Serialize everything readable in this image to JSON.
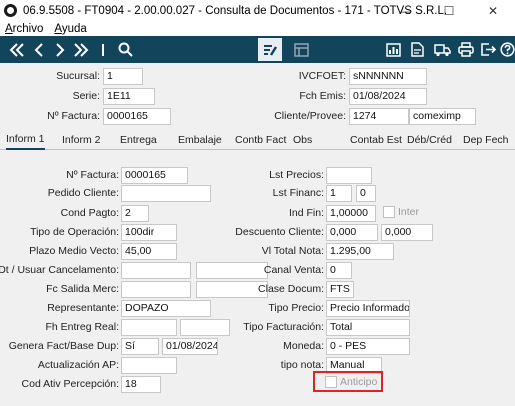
{
  "window": {
    "title": "06.9.5508 - FT0904 - 2.00.00.027 - Consulta de Documentos - 171 - TOTVS S.R.L.",
    "minimize": "—",
    "maximize": "☐",
    "close": "✕"
  },
  "menu": {
    "archivo_first": "A",
    "archivo_rest": "rchivo",
    "ayuda_first": "A",
    "ayuda_rest": "yuda"
  },
  "toolbar": {
    "left_icons": [
      "first-icon",
      "previous-icon",
      "next-icon",
      "last-icon",
      "search-icon"
    ],
    "right_icons": [
      "edit-icon",
      "grid-icon",
      "chart-icon",
      "document-icon",
      "truck-icon",
      "print-icon",
      "exit-icon",
      "help-icon"
    ]
  },
  "header": {
    "sucursal_label": "Sucursal:",
    "sucursal_value": "1",
    "serie_label": "Serie:",
    "serie_value": "1E11",
    "nfactura_label": "Nº Factura:",
    "nfactura_value": "0000165",
    "ivcfoet_label": "IVCFOET:",
    "ivcfoet_value": "sNNNNNN",
    "fchemis_label": "Fch Emis:",
    "fchemis_value": "01/08/2024",
    "cliente_label": "Cliente/Provee:",
    "cliente_code": "1274",
    "cliente_name": "comeximp"
  },
  "tabs": [
    "Inform 1",
    "Inform 2",
    "Entrega",
    "Embalaje",
    "Contb Fact",
    "Obs",
    "Contab Est",
    "Déb/Créd",
    "Dep Fech"
  ],
  "form": {
    "nfactura_label": "Nº Factura:",
    "nfactura_value": "0000165",
    "pedido_label": "Pedido Cliente:",
    "pedido_value": "",
    "condpagto_label": "Cond Pagto:",
    "condpagto_value": "2",
    "tipooper_label": "Tipo de Operación:",
    "tipooper_value": "100dir",
    "plazo_label": "Plazo Medio Vecto:",
    "plazo_value": "45,00",
    "dtusuar_label": "Dt / Usuar Cancelamento:",
    "dtusuar_value1": "",
    "dtusuar_value2": "",
    "fcsalida_label": "Fc Salida Merc:",
    "fcsalida_value1": "",
    "fcsalida_value2": "",
    "represent_label": "Representante:",
    "represent_value": "DOPAZO",
    "fhentreg_label": "Fh Entreg Real:",
    "fhentreg_value1": "",
    "fhentreg_value2": "",
    "genera_label": "Genera Fact/Base Dup:",
    "genera_value1": "Sí",
    "genera_value2": "01/08/2024",
    "actualiz_label": "Actualización AP:",
    "actualiz_value": "",
    "codativ_label": "Cod Ativ Percepción:",
    "codativ_value": "18",
    "lstprecios_label": "Lst Precios:",
    "lstprecios_value": "",
    "lstfinanc_label": "Lst Financ:",
    "lstfinanc_value1": "1",
    "lstfinanc_value2": "0",
    "indfin_label": "Ind Fin:",
    "indfin_value": "1,00000",
    "inter_label": "Inter",
    "descuento_label": "Descuento Cliente:",
    "descuento_value1": "0,000",
    "descuento_value2": "0,000",
    "vltotal_label": "Vl Total Nota:",
    "vltotal_value": "1.295,00",
    "canalventa_label": "Canal Venta:",
    "canalventa_value": "0",
    "clasedocum_label": "Clase Docum:",
    "clasedocum_value": "FTS",
    "tipoprecio_label": "Tipo Precio:",
    "tipoprecio_value": "Precio Informado",
    "tipofact_label": "Tipo Facturación:",
    "tipofact_value": "Total",
    "moneda_label": "Moneda:",
    "moneda_value": "0 - PES",
    "tiponota_label": "tipo nota:",
    "tiponota_value": "Manual",
    "anticipo_label": "Anticipo"
  },
  "colors": {
    "toolbar": "#12445c",
    "highlight": "#d9262b"
  }
}
